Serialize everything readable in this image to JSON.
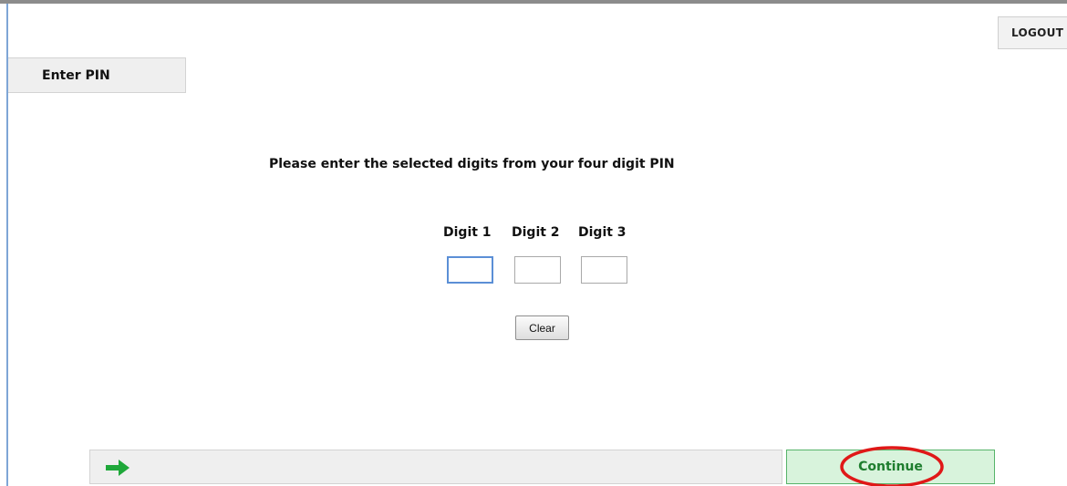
{
  "header": {
    "logout_label": "LOGOUT"
  },
  "tab": {
    "label": "Enter PIN"
  },
  "main": {
    "instruction": "Please enter the selected digits from your four digit PIN",
    "digits": [
      {
        "label": "Digit 1",
        "value": ""
      },
      {
        "label": "Digit 2",
        "value": ""
      },
      {
        "label": "Digit 3",
        "value": ""
      }
    ],
    "clear_label": "Clear"
  },
  "footer": {
    "arrow_icon": "right-arrow-icon",
    "continue_label": "Continue"
  },
  "colors": {
    "arrow": "#1fa83a",
    "continue_bg": "#d8f3dc",
    "continue_text": "#1e7d2e",
    "highlight": "#e01818"
  }
}
